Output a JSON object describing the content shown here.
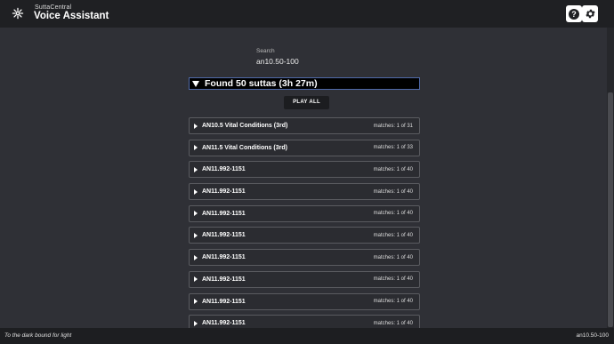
{
  "app": {
    "subtitle": "SuttaCentral",
    "title": "Voice Assistant",
    "logo_icon": "dharma-wheel-icon"
  },
  "toolbar": {
    "help_icon": "help-icon",
    "settings_icon": "gear-icon"
  },
  "search": {
    "label": "Search",
    "value": "an10.50-100"
  },
  "results": {
    "summary": "Found 50 suttas (3h 27m)",
    "play_all": "PLAY ALL",
    "items": [
      {
        "title": "AN10.5 Vital Conditions (3rd)",
        "matches": "matches: 1 of 31"
      },
      {
        "title": "AN11.5 Vital Conditions (3rd)",
        "matches": "matches: 1 of 33"
      },
      {
        "title": "AN11.992-1151",
        "matches": "matches: 1 of 40"
      },
      {
        "title": "AN11.992-1151",
        "matches": "matches: 1 of 40"
      },
      {
        "title": "AN11.992-1151",
        "matches": "matches: 1 of 40"
      },
      {
        "title": "AN11.992-1151",
        "matches": "matches: 1 of 40"
      },
      {
        "title": "AN11.992-1151",
        "matches": "matches: 1 of 40"
      },
      {
        "title": "AN11.992-1151",
        "matches": "matches: 1 of 40"
      },
      {
        "title": "AN11.992-1151",
        "matches": "matches: 1 of 40"
      },
      {
        "title": "AN11.992-1151",
        "matches": "matches: 1 of 40"
      }
    ]
  },
  "status": {
    "left": "To the dark bound for light",
    "right": "an10.50-100"
  }
}
